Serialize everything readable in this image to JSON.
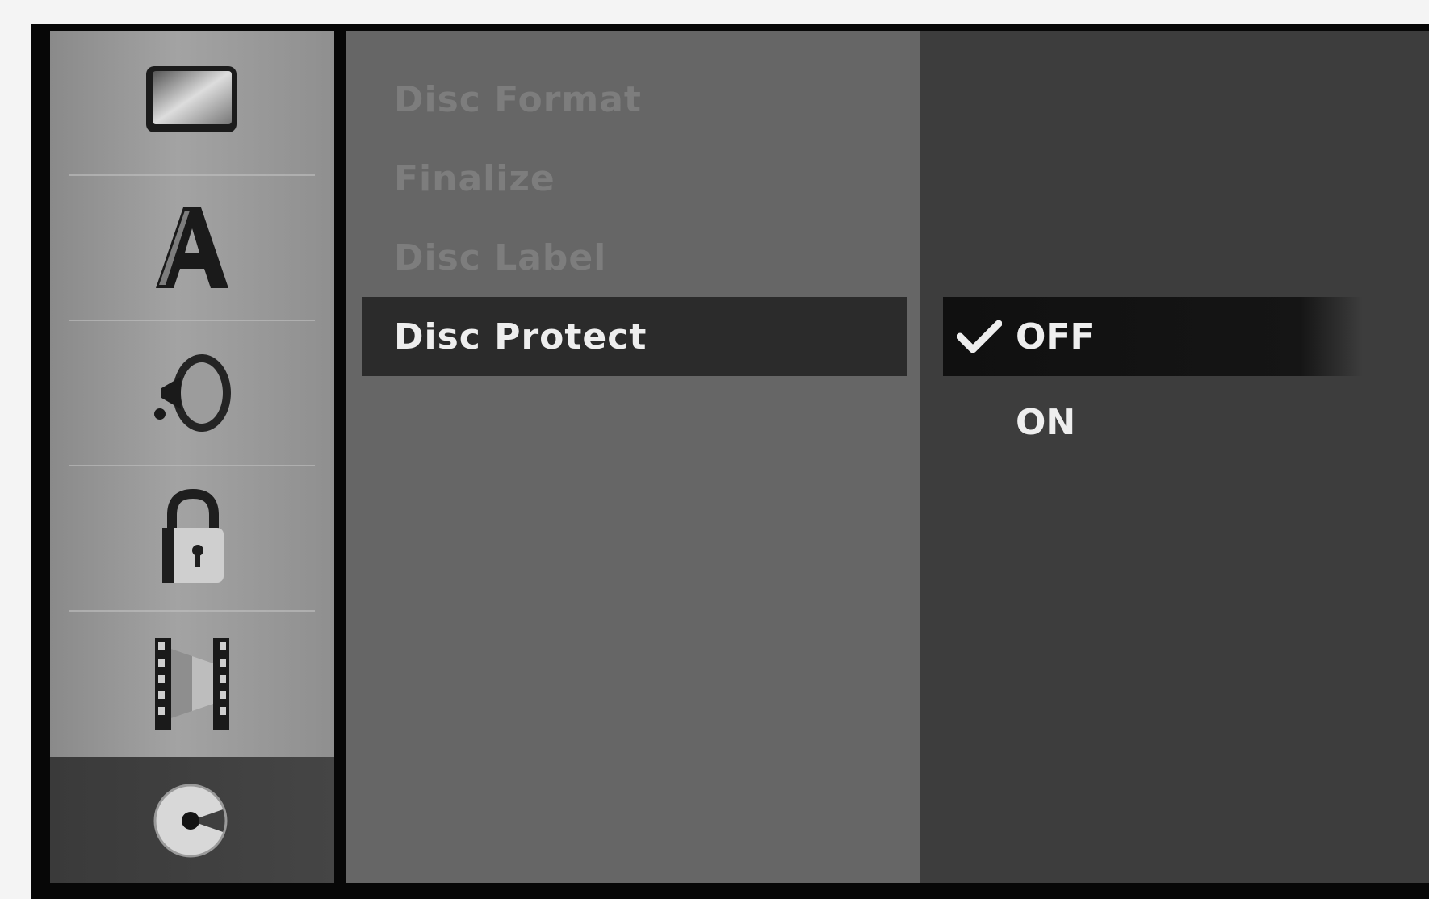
{
  "sidebar": {
    "icons": [
      {
        "name": "tv-screen-icon",
        "selected": false
      },
      {
        "name": "language-icon",
        "selected": false
      },
      {
        "name": "speaker-icon",
        "selected": false
      },
      {
        "name": "lock-icon",
        "selected": false
      },
      {
        "name": "film-icon",
        "selected": false
      },
      {
        "name": "disc-icon",
        "selected": true
      }
    ]
  },
  "menu": {
    "items": [
      {
        "label": "Disc Format"
      },
      {
        "label": "Finalize"
      },
      {
        "label": "Disc Label"
      },
      {
        "label": "Disc Protect"
      }
    ],
    "selected_index": 3
  },
  "options": {
    "items": [
      {
        "label": "OFF",
        "checked": true
      },
      {
        "label": "ON",
        "checked": false
      }
    ]
  },
  "colors": {
    "screen_bg": "#070707",
    "sidebar_bg": "#9a9a9a",
    "menu_bg": "#666666",
    "options_bg": "#3d3d3d",
    "highlight": "#2b2b2b",
    "text_active": "#eeeeee",
    "text_dim": "#7d7d7d"
  }
}
